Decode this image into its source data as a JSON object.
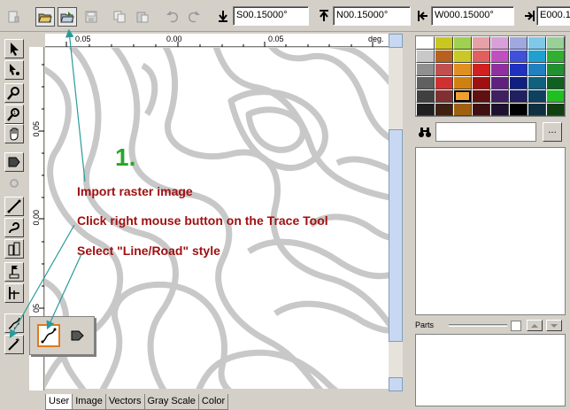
{
  "coords": {
    "s_value": "S00.15000°",
    "n_value": "N00.15000°",
    "w_value": "W000.15000°",
    "e_value": "E000.1"
  },
  "ruler_top": {
    "labels": [
      "0.05",
      "0.00",
      "0.05",
      "deg."
    ]
  },
  "ruler_left": {
    "labels": [
      "0.05",
      "0.00",
      "05"
    ]
  },
  "tabs": [
    "User",
    "Image",
    "Vectors",
    "Gray Scale",
    "Color"
  ],
  "active_tab": "User",
  "right_panel": {
    "parts_label": "Parts",
    "browse_label": "..."
  },
  "palette": {
    "colors": [
      "#ffffff",
      "#c8c820",
      "#a0d050",
      "#e8a0a8",
      "#d8a0d8",
      "#a0a8e0",
      "#80c8e8",
      "#98d098",
      "#c8c8c8",
      "#b86020",
      "#c8c828",
      "#e06060",
      "#c050c0",
      "#4050d8",
      "#20a0d0",
      "#30b030",
      "#909090",
      "#c05050",
      "#e09020",
      "#d02020",
      "#9030a0",
      "#2030c0",
      "#2080c0",
      "#209030",
      "#606060",
      "#d03030",
      "#d08010",
      "#a01010",
      "#602080",
      "#102080",
      "#106080",
      "#106020",
      "#404040",
      "#803030",
      "#f0a030",
      "#601010",
      "#402060",
      "#202060",
      "#104060",
      "#20c020",
      "#202020",
      "#402010",
      "#a06010",
      "#401010",
      "#201030",
      "#000000",
      "#103040",
      "#104010"
    ],
    "selected_index": 34
  },
  "annotations": {
    "step": "1.",
    "line1": "Import raster image",
    "line2": "Click right mouse button on the Trace Tool",
    "line3": "Select \"Line/Road\" style"
  }
}
